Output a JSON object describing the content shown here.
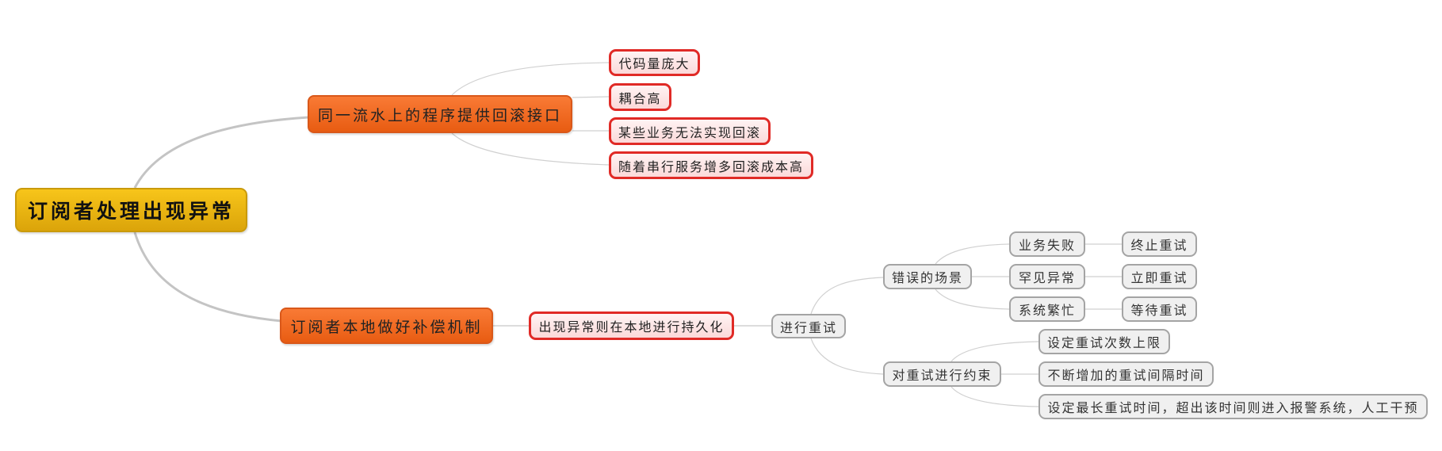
{
  "root": {
    "label": "订阅者处理出现异常"
  },
  "branches": [
    {
      "label": "同一流水上的程序提供回滚接口",
      "children": [
        "代码量庞大",
        "耦合高",
        "某些业务无法实现回滚",
        "随着串行服务增多回滚成本高"
      ]
    },
    {
      "label": "订阅者本地做好补偿机制",
      "child": {
        "label": "出现异常则在本地进行持久化",
        "child": {
          "label": "进行重试",
          "children": [
            {
              "label": "错误的场景",
              "children": [
                {
                  "label": "业务失败",
                  "action": "终止重试"
                },
                {
                  "label": "罕见异常",
                  "action": "立即重试"
                },
                {
                  "label": "系统繁忙",
                  "action": "等待重试"
                }
              ]
            },
            {
              "label": "对重试进行约束",
              "children": [
                "设定重试次数上限",
                "不断增加的重试间隔时间",
                "设定最长重试时间，超出该时间则进入报警系统，人工干预"
              ]
            }
          ]
        }
      }
    }
  ],
  "colors": {
    "root": "#e8b20f",
    "main": "#f26c22",
    "leaf_border": "#e02a26",
    "link": "#c8c8c8"
  }
}
